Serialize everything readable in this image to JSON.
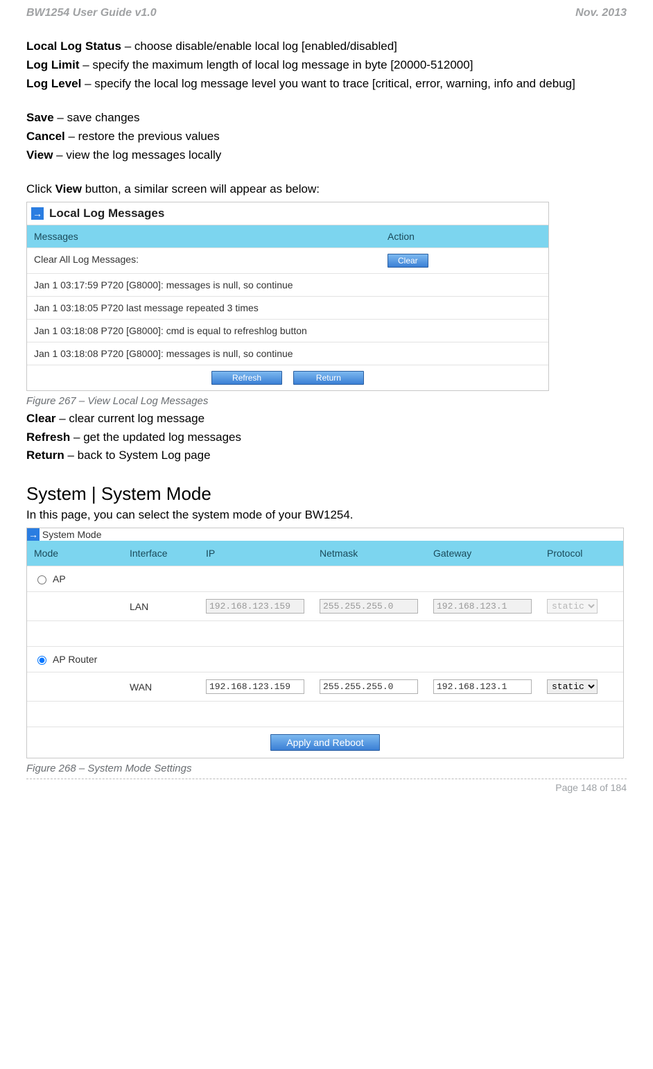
{
  "header": {
    "left": "BW1254 User Guide v1.0",
    "right": "Nov.  2013"
  },
  "intro": {
    "localLogStatus": {
      "label": "Local Log Status",
      "desc": " – choose disable/enable local log [enabled/disabled]"
    },
    "logLimit": {
      "label": "Log Limit",
      "desc": " – specify the maximum length of local log message in byte [20000-512000]"
    },
    "logLevel": {
      "label": "Log Level",
      "desc": " – specify the local log message level you want to trace [critical, error, warning, info and debug]"
    },
    "save": {
      "label": "Save",
      "desc": " – save changes"
    },
    "cancel": {
      "label": "Cancel",
      "desc": " – restore the previous values"
    },
    "view": {
      "label": "View",
      "desc": " – view the log messages locally"
    },
    "clickViewPre": "Click ",
    "clickViewBold": "View",
    "clickViewPost": " button, a similar screen will appear as below:"
  },
  "panel1": {
    "title": "Local Log Messages",
    "colMsg": "Messages",
    "colAct": "Action",
    "clearRowLabel": "Clear All Log Messages:",
    "clearBtn": "Clear",
    "rows": [
      "Jan 1 03:17:59 P720 [G8000]: messages is null, so continue",
      "Jan 1 03:18:05 P720 last message repeated 3 times",
      "Jan 1 03:18:08 P720 [G8000]: cmd is equal to refreshlog button",
      "Jan 1 03:18:08 P720 [G8000]: messages is null, so continue"
    ],
    "refreshBtn": "Refresh",
    "returnBtn": "Return"
  },
  "fig267": "Figure 267 – View Local Log Messages",
  "afterPanel1": {
    "clear": {
      "label": "Clear",
      "desc": " – clear current log message"
    },
    "refresh": {
      "label": "Refresh",
      "desc": " – get the updated log messages"
    },
    "return": {
      "label": "Return",
      "desc": " – back to System Log page"
    }
  },
  "sectionHeading": "System | System Mode",
  "sectionText": "In this page, you can select the system mode of your BW1254.",
  "panel2": {
    "title": "System Mode",
    "cols": {
      "mode": "Mode",
      "interface": "Interface",
      "ip": "IP",
      "netmask": "Netmask",
      "gateway": "Gateway",
      "protocol": "Protocol"
    },
    "ap": {
      "label": "AP",
      "iface": "LAN",
      "ip": "192.168.123.159",
      "netmask": "255.255.255.0",
      "gateway": "192.168.123.1",
      "protocol": "static"
    },
    "aprouter": {
      "label": "AP Router",
      "iface": "WAN",
      "ip": "192.168.123.159",
      "netmask": "255.255.255.0",
      "gateway": "192.168.123.1",
      "protocol": "static"
    },
    "applyBtn": "Apply and Reboot"
  },
  "fig268": "Figure 268 – System Mode Settings",
  "footer": "Page 148 of 184"
}
